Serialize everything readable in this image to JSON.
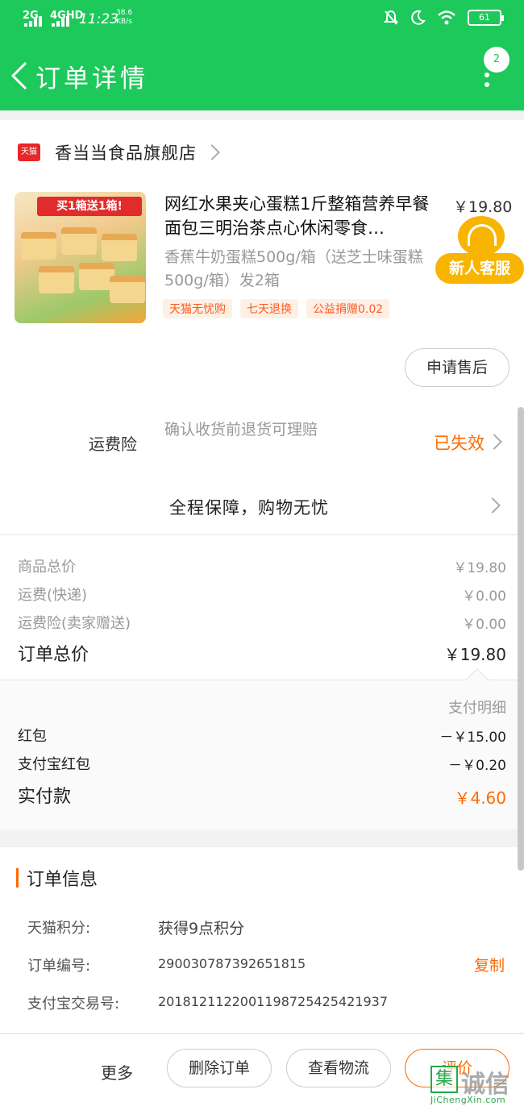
{
  "status_bar": {
    "sig1": "2G",
    "sig2": "4GHD",
    "time": "11:23",
    "speed_value": "38.6",
    "speed_unit": "KB/s",
    "battery": "61"
  },
  "header": {
    "title": "订单详情",
    "msg_count": "2"
  },
  "store": {
    "logo_text": "天猫",
    "name": "香当当食品旗舰店"
  },
  "product": {
    "image_banner": "买1箱送1箱!",
    "title": "网红水果夹心蛋糕1斤整箱营养早餐面包三明治茶点心休闲零食…",
    "price": "￥19.80",
    "sku": "香蕉牛奶蛋糕500g/箱（送芝士味蛋糕500g/箱）发2箱",
    "tags": [
      "天猫无忧购",
      "七天退换",
      "公益捐赠0.02"
    ],
    "after_sale_button": "申请售后"
  },
  "service_float": {
    "label": "新人客服"
  },
  "insurance": {
    "label": "运费险",
    "desc": "确认收货前退货可理赔",
    "status": "已失效",
    "guarantee": "全程保障，购物无忧"
  },
  "totals": {
    "goods_label": "商品总价",
    "goods_value": "￥19.80",
    "shipping_label": "运费(快递)",
    "shipping_value": "￥0.00",
    "insurance_label": "运费险(卖家赠送)",
    "insurance_value": "￥0.00",
    "order_label": "订单总价",
    "order_value": "￥19.80"
  },
  "payment": {
    "detail_link": "支付明细",
    "red_packet_label": "红包",
    "red_packet_value": "－￥15.00",
    "alipay_packet_label": "支付宝红包",
    "alipay_packet_value": "－￥0.20",
    "paid_label": "实付款",
    "paid_value": "￥4.60"
  },
  "order_info": {
    "title": "订单信息",
    "points_label": "天猫积分:",
    "points_value": "获得9点积分",
    "order_no_label": "订单编号:",
    "order_no_value": "290030787392651815",
    "copy": "复制",
    "alipay_no_label": "支付宝交易号:",
    "alipay_no_value": "2018121122001198725425421937"
  },
  "footer": {
    "more": "更多",
    "delete": "删除订单",
    "logistics": "查看物流",
    "review": "评价"
  },
  "watermark": {
    "mark": "集",
    "text": "诚信",
    "sub": "JiChengXin.com"
  },
  "colors": {
    "brand_green": "#1ec95b",
    "accent_orange": "#ff6a00",
    "tmall_red": "#e62828"
  }
}
